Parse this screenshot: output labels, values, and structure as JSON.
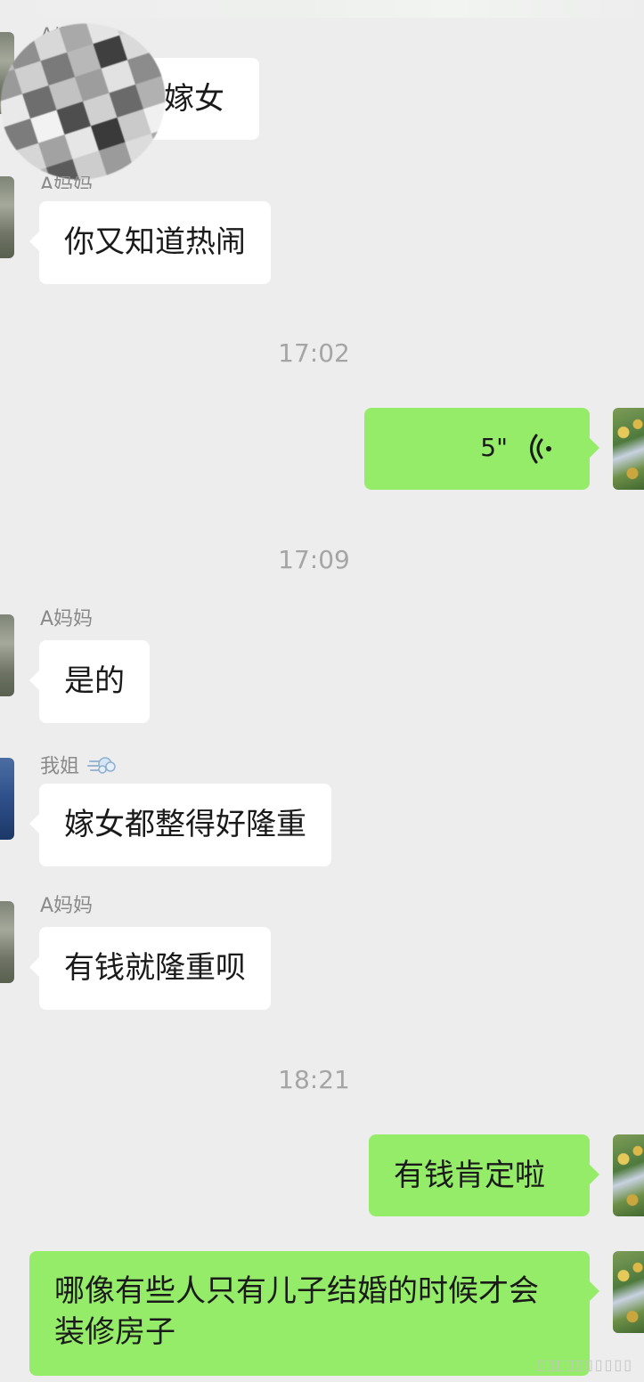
{
  "messages": {
    "m1": {
      "sender": "A妈妈",
      "text": "嫁女"
    },
    "m2": {
      "sender": "A妈妈",
      "text": "你又知道热闹"
    },
    "t1": "17:02",
    "m3": {
      "voice_duration": "5\""
    },
    "t2": "17:09",
    "m4": {
      "sender": "A妈妈",
      "text": "是的"
    },
    "m5": {
      "sender": "我姐",
      "text": "嫁女都整得好隆重"
    },
    "m6": {
      "sender": "A妈妈",
      "text": "有钱就隆重呗"
    },
    "t3": "18:21",
    "m7": {
      "text": "有钱肯定啦"
    },
    "m8": {
      "text": "哪像有些人只有儿子结婚的时候才会装修房子"
    }
  },
  "icons": {
    "voice": "voice-wave-icon",
    "sister_emoji": "dash-emoji-icon"
  },
  "colors": {
    "background": "#ededed",
    "incoming_bubble": "#ffffff",
    "outgoing_bubble": "#95ec69",
    "timestamp": "#a5a5a5",
    "sender_name": "#8a8a8a"
  }
}
